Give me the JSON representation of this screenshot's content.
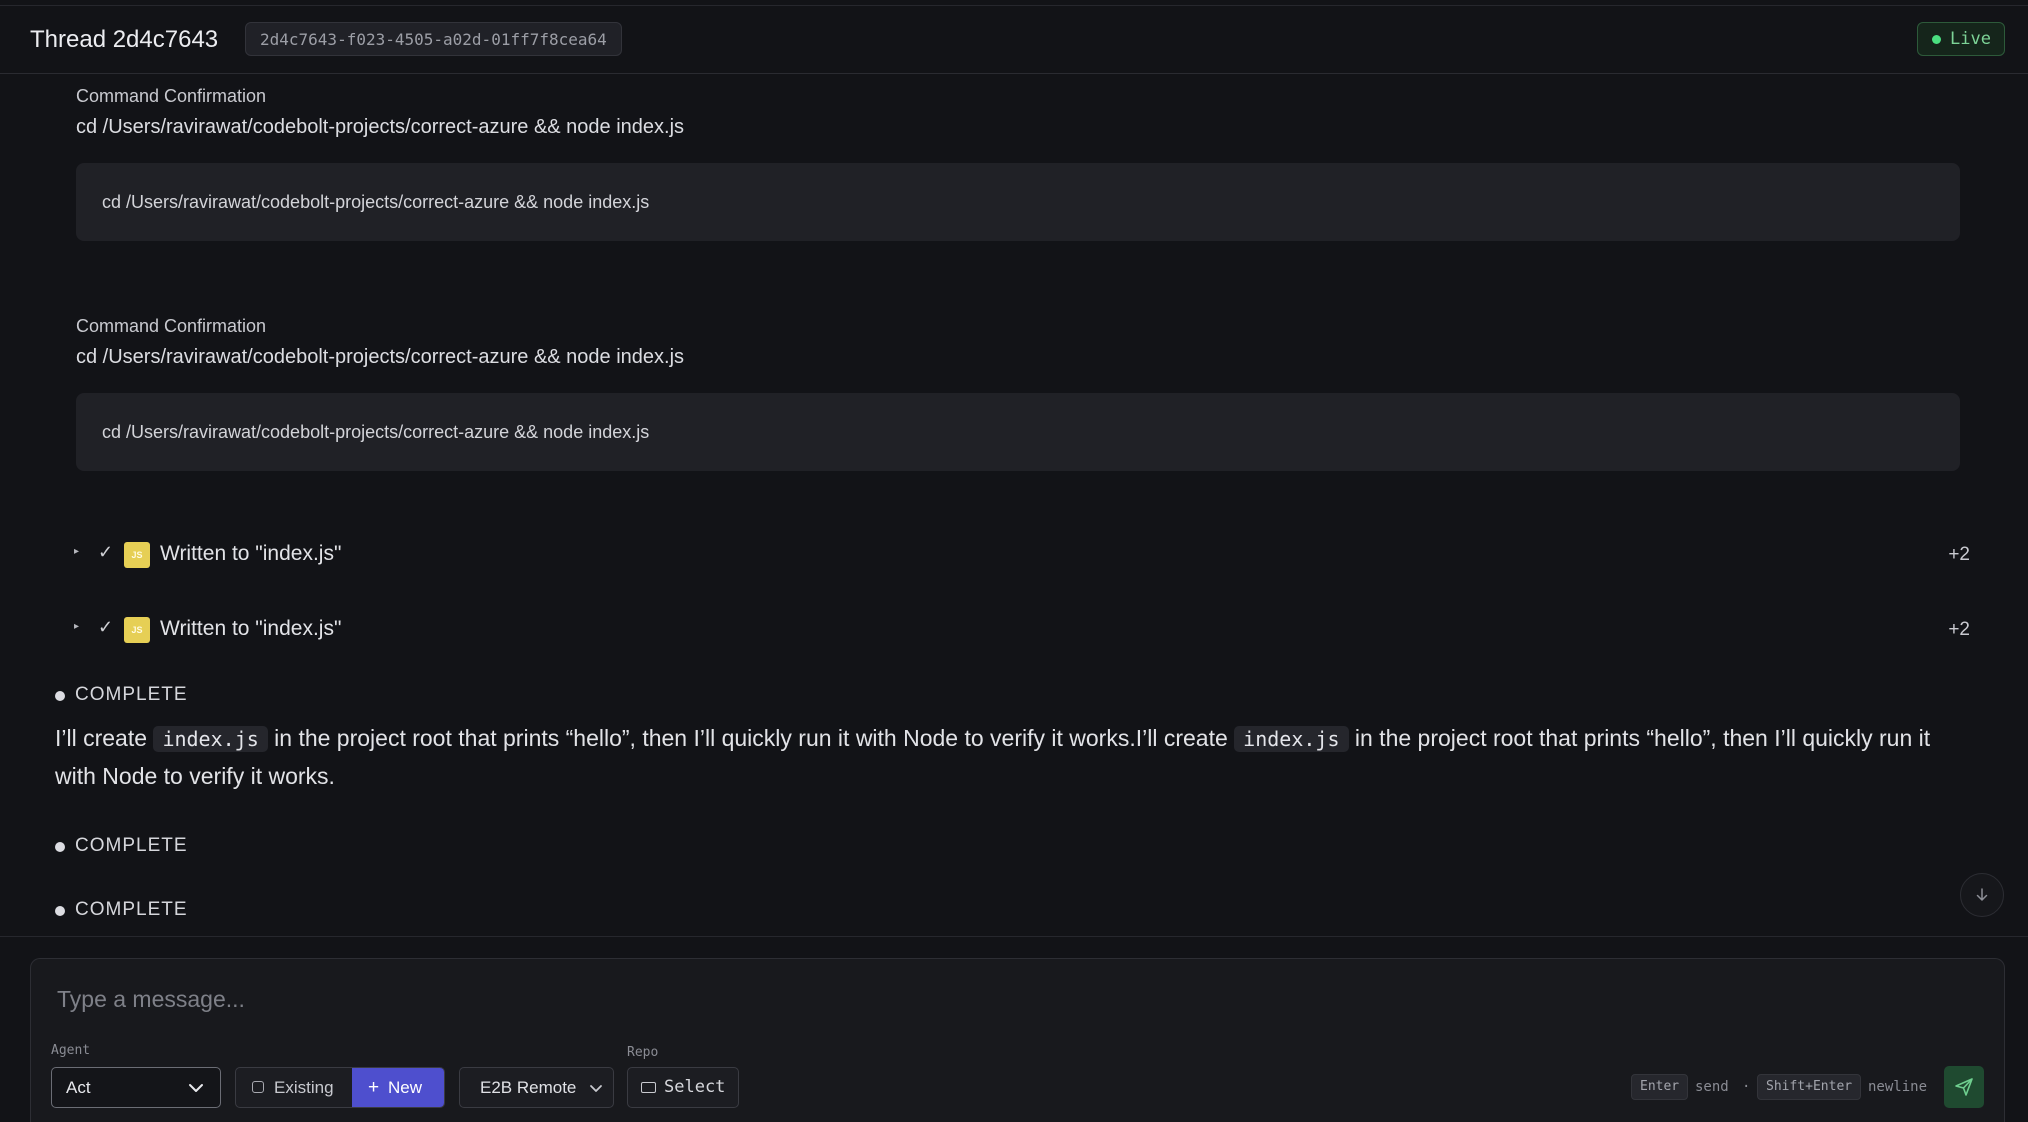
{
  "header": {
    "title": "Thread 2d4c7643",
    "thread_id": "2d4c7643-f023-4505-a02d-01ff7f8cea64",
    "status": "Live"
  },
  "messages": {
    "commands": [
      {
        "label": "Command Confirmation",
        "command": "cd /Users/ravirawat/codebolt-projects/correct-azure && node index.js",
        "box": "cd /Users/ravirawat/codebolt-projects/correct-azure && node index.js"
      },
      {
        "label": "Command Confirmation",
        "command": "cd /Users/ravirawat/codebolt-projects/correct-azure && node index.js",
        "box": "cd /Users/ravirawat/codebolt-projects/correct-azure && node index.js"
      }
    ],
    "writes": [
      {
        "badge": "JS",
        "label": "Written to \"index.js\"",
        "count": "+2"
      },
      {
        "badge": "JS",
        "label": "Written to \"index.js\"",
        "count": "+2"
      }
    ],
    "statuses": [
      "COMPLETE",
      "COMPLETE",
      "COMPLETE"
    ],
    "paragraph": {
      "seg1": "I’ll create ",
      "code1": "index.js",
      "seg2": " in the project root that prints “hello”, then I’ll quickly run it with Node to verify it works.I’ll create ",
      "code2": "index.js",
      "seg3": " in the project root that prints “hello”, then I’ll quickly run it with Node to verify it works."
    }
  },
  "composer": {
    "placeholder": "Type a message...",
    "agent_label": "Agent",
    "agent_value": "Act",
    "existing_label": "Existing",
    "new_label": "New",
    "environment": "E2B Remote",
    "repo_label": "Repo",
    "repo_button": "Select",
    "hint_enter_key": "Enter",
    "hint_enter_action": "send",
    "hint_separator": "·",
    "hint_shift_key": "Shift+Enter",
    "hint_shift_action": "newline"
  },
  "colors": {
    "background": "#121317",
    "accent": "#4e4fce",
    "live": "#4ade80",
    "js_badge": "#e6cf55",
    "send": "#1f4a30"
  },
  "icons": [
    "caret-right-icon",
    "check-icon",
    "js-file-icon",
    "arrow-down-icon",
    "chevron-down-icon",
    "cube-icon",
    "plus-icon",
    "folder-icon",
    "send-icon"
  ]
}
